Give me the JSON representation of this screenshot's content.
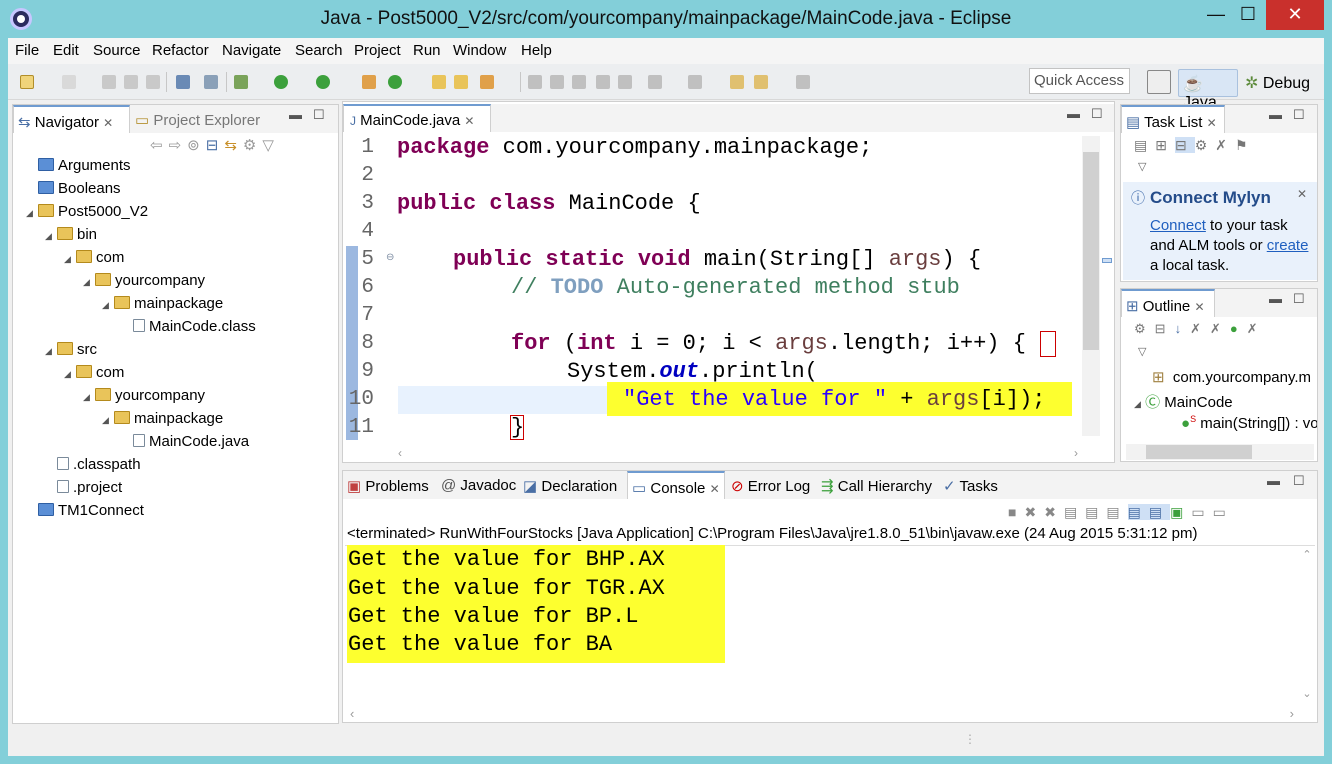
{
  "window": {
    "title": "Java - Post5000_V2/src/com/yourcompany/mainpackage/MainCode.java - Eclipse",
    "min": "—",
    "max": "☐",
    "close": "✕"
  },
  "menu": [
    "File",
    "Edit",
    "Source",
    "Refactor",
    "Navigate",
    "Search",
    "Project",
    "Run",
    "Window",
    "Help"
  ],
  "toolbar": {
    "quick_access_placeholder": "Quick Access",
    "perspectives": {
      "java": "Java",
      "debug": "Debug"
    }
  },
  "navigator": {
    "tabs": [
      "Navigator",
      "Project Explorer"
    ],
    "tree": [
      {
        "label": "Arguments",
        "icon": "bluefolder",
        "depth": 0,
        "twisty": ""
      },
      {
        "label": "Booleans",
        "icon": "bluefolder",
        "depth": 0,
        "twisty": ""
      },
      {
        "label": "Post5000_V2",
        "icon": "projfolder",
        "depth": 0,
        "twisty": "◢"
      },
      {
        "label": "bin",
        "icon": "folder",
        "depth": 1,
        "twisty": "◢"
      },
      {
        "label": "com",
        "icon": "folder",
        "depth": 2,
        "twisty": "◢"
      },
      {
        "label": "yourcompany",
        "icon": "folder",
        "depth": 3,
        "twisty": "◢"
      },
      {
        "label": "mainpackage",
        "icon": "folder",
        "depth": 4,
        "twisty": "◢"
      },
      {
        "label": "MainCode.class",
        "icon": "file",
        "depth": 5,
        "twisty": ""
      },
      {
        "label": "src",
        "icon": "folder",
        "depth": 1,
        "twisty": "◢"
      },
      {
        "label": "com",
        "icon": "folder",
        "depth": 2,
        "twisty": "◢"
      },
      {
        "label": "yourcompany",
        "icon": "folder",
        "depth": 3,
        "twisty": "◢"
      },
      {
        "label": "mainpackage",
        "icon": "folder",
        "depth": 4,
        "twisty": "◢"
      },
      {
        "label": "MainCode.java",
        "icon": "file",
        "depth": 5,
        "twisty": ""
      },
      {
        "label": ".classpath",
        "icon": "file",
        "depth": 1,
        "twisty": ""
      },
      {
        "label": ".project",
        "icon": "file",
        "depth": 1,
        "twisty": ""
      },
      {
        "label": "TM1Connect",
        "icon": "bluefolder",
        "depth": 0,
        "twisty": ""
      }
    ]
  },
  "editor": {
    "tab": "MainCode.java",
    "line_numbers": [
      "1",
      "2",
      "3",
      "4",
      "5",
      "6",
      "7",
      "8",
      "9",
      "10",
      "11"
    ],
    "code": {
      "l1_kw": "package",
      "l1_rest": " com.yourcompany.mainpackage;",
      "l3_kw": "public class",
      "l3_rest": " MainCode {",
      "l5_kw": "public static void",
      "l5_rest": " main(String[] ",
      "l5_var": "args",
      "l5_end": ") {",
      "l6_c1": "// ",
      "l6_todo": "TODO",
      "l6_c2": " Auto-generated method stub",
      "l8_kw1": "for",
      "l8_a": " (",
      "l8_kw2": "int",
      "l8_b": " i = 0; i < ",
      "l8_var": "args",
      "l8_c": ".length; i++) ",
      "l8_brace": "{",
      "l9_a": "System.",
      "l9_fld": "out",
      "l9_b": ".println(",
      "l10_str": "\"Get the value for \"",
      "l10_a": " + ",
      "l10_var": "args",
      "l10_b": "[i]);",
      "l11": "}"
    }
  },
  "tasklist": {
    "tab": "Task List",
    "mylyn_title": "Connect Mylyn",
    "mylyn_link1": "Connect",
    "mylyn_text1": " to your task",
    "mylyn_text2": "and ALM tools or ",
    "mylyn_link2": "create",
    "mylyn_text3": "a local task."
  },
  "outline": {
    "tab": "Outline",
    "items": [
      "com.yourcompany.m",
      "MainCode",
      "main(String[]) : vo"
    ]
  },
  "bottom": {
    "tabs": [
      "Problems",
      "Javadoc",
      "Declaration",
      "Console",
      "Error Log",
      "Call Hierarchy",
      "Tasks"
    ],
    "console_header": "<terminated> RunWithFourStocks [Java Application] C:\\Program Files\\Java\\jre1.8.0_51\\bin\\javaw.exe (24 Aug 2015 5:31:12 pm)",
    "output": [
      "Get the value for BHP.AX",
      "Get the value for TGR.AX",
      "Get the value for BP.L",
      "Get the value for BA"
    ]
  },
  "colors": {
    "titlebar": "#83cfd9",
    "close_button": "#c9302c",
    "highlight": "#fdff2f",
    "keyword": "#7f0055",
    "comment": "#3f7f5f",
    "string": "#2a00ff"
  }
}
